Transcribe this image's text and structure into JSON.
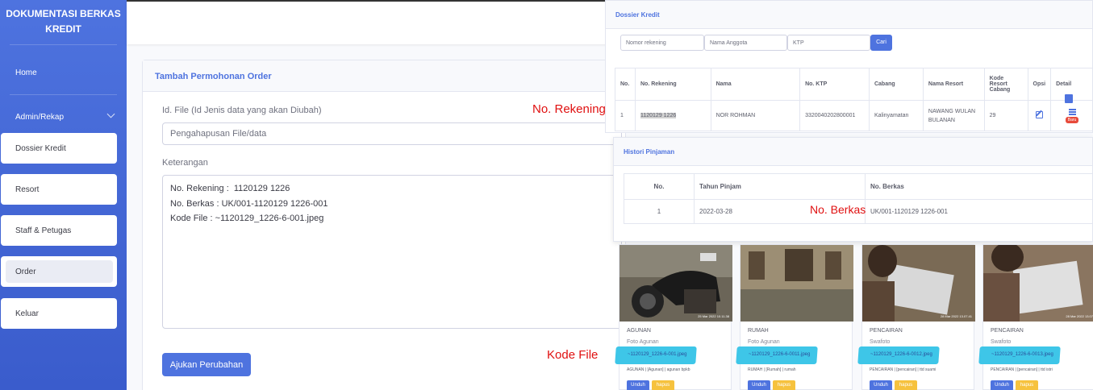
{
  "sidebar": {
    "brand_line1": "DOKUMENTASI BERKAS",
    "brand_line2": "KREDIT",
    "home": "Home",
    "admin": "Admin/Rekap",
    "items": [
      "Dossier Kredit",
      "Resort",
      "Staff & Petugas",
      "Order",
      "Keluar"
    ],
    "active_item": "Order"
  },
  "form": {
    "title": "Tambah Permohonan Order",
    "idfile_label": "Id. File (Id Jenis data yang akan Diubah)",
    "idfile_value": "Pengahapusan File/data",
    "keterangan_label": "Keterangan",
    "keterangan_lines": [
      "No. Rekening :  1120129 1226",
      "No. Berkas : UK/001-1120129 1226-001",
      "Kode File : ~1120129_1226-6-001.jpeg"
    ],
    "submit": "Ajukan Perubahan"
  },
  "annotations": {
    "rekening": "No. Rekening",
    "berkas": "No. Berkas",
    "kodefile": "Kode File"
  },
  "dossier": {
    "title": "Dossier Kredit",
    "search_rekening": "Nomor rekening",
    "search_nama": "Nama Anggota",
    "search_ktp": "KTP",
    "search_button": "Cari",
    "headers": [
      "No.",
      "No. Rekening",
      "Nama",
      "No. KTP",
      "Cabang",
      "Nama Resort",
      "Kode Resort Cabang",
      "Opsi",
      "Detail"
    ],
    "row": {
      "no": "1",
      "rekening": "1120129 1226",
      "nama": "NOR ROHMAN",
      "ktp": "3320040202800001",
      "cabang": "Kalinyamatan",
      "resort": "NAWANG WULAN BULANAN",
      "kode": "29",
      "badge": "Baru"
    }
  },
  "histori": {
    "title": "Histori Pinjaman",
    "headers": [
      "No.",
      "Tahun Pinjam",
      "No. Berkas"
    ],
    "row": {
      "no": "1",
      "tahun": "2022-03-28",
      "berkas": "UK/001-1120129 1226-001"
    }
  },
  "photos": [
    {
      "category": "AGUNAN",
      "subtitle": "Foto Agunan",
      "file": "~1120129_1226-6-001.jpeg",
      "tags": "AGUNAN | [Agunan] | agunan bpkb",
      "stamp": "25 Mar 2022 10.11.38"
    },
    {
      "category": "RUMAH",
      "subtitle": "Foto Agunan",
      "file": "~1120129_1226-6-0011.jpeg",
      "tags": "RUMAH | [Rumah] | rumah",
      "stamp": ""
    },
    {
      "category": "PENCAIRAN",
      "subtitle": "Swafoto",
      "file": "~1120129_1226-6-0012.jpeg",
      "tags": "PENCAIRAN | [pencairan] | ttd suami",
      "stamp": "28 Mar 2022 13.07.41"
    },
    {
      "category": "PENCAIRAN",
      "subtitle": "Swafoto",
      "file": "~1120129_1226-6-0013.jpeg",
      "tags": "PENCAIRAN | [pencairan] | ttd istri",
      "stamp": "28 Mar 2022 13.07"
    }
  ],
  "photo_buttons": {
    "download": "Unduh",
    "delete": "hapus"
  },
  "colors": {
    "primary": "#4e73df",
    "annotation": "#e01010",
    "highlight": "#3ec6e8",
    "badge": "#e74a3b",
    "warning": "#f6c23e"
  }
}
